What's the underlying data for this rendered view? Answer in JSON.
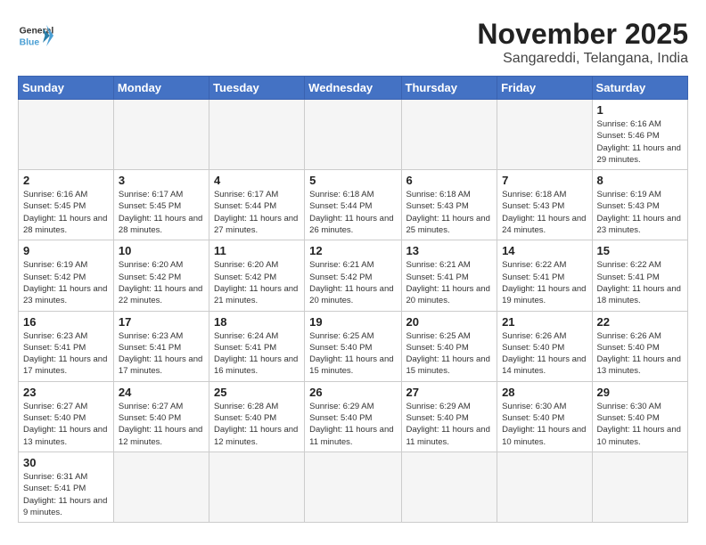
{
  "header": {
    "logo_general": "General",
    "logo_blue": "Blue",
    "month_title": "November 2025",
    "location": "Sangareddi, Telangana, India"
  },
  "days_of_week": [
    "Sunday",
    "Monday",
    "Tuesday",
    "Wednesday",
    "Thursday",
    "Friday",
    "Saturday"
  ],
  "weeks": [
    [
      {
        "day": "",
        "empty": true
      },
      {
        "day": "",
        "empty": true
      },
      {
        "day": "",
        "empty": true
      },
      {
        "day": "",
        "empty": true
      },
      {
        "day": "",
        "empty": true
      },
      {
        "day": "",
        "empty": true
      },
      {
        "day": "1",
        "sunrise": "6:16 AM",
        "sunset": "5:46 PM",
        "daylight": "11 hours and 29 minutes."
      }
    ],
    [
      {
        "day": "2",
        "sunrise": "6:16 AM",
        "sunset": "5:45 PM",
        "daylight": "11 hours and 28 minutes."
      },
      {
        "day": "3",
        "sunrise": "6:17 AM",
        "sunset": "5:45 PM",
        "daylight": "11 hours and 28 minutes."
      },
      {
        "day": "4",
        "sunrise": "6:17 AM",
        "sunset": "5:44 PM",
        "daylight": "11 hours and 27 minutes."
      },
      {
        "day": "5",
        "sunrise": "6:18 AM",
        "sunset": "5:44 PM",
        "daylight": "11 hours and 26 minutes."
      },
      {
        "day": "6",
        "sunrise": "6:18 AM",
        "sunset": "5:43 PM",
        "daylight": "11 hours and 25 minutes."
      },
      {
        "day": "7",
        "sunrise": "6:18 AM",
        "sunset": "5:43 PM",
        "daylight": "11 hours and 24 minutes."
      },
      {
        "day": "8",
        "sunrise": "6:19 AM",
        "sunset": "5:43 PM",
        "daylight": "11 hours and 23 minutes."
      }
    ],
    [
      {
        "day": "9",
        "sunrise": "6:19 AM",
        "sunset": "5:42 PM",
        "daylight": "11 hours and 23 minutes."
      },
      {
        "day": "10",
        "sunrise": "6:20 AM",
        "sunset": "5:42 PM",
        "daylight": "11 hours and 22 minutes."
      },
      {
        "day": "11",
        "sunrise": "6:20 AM",
        "sunset": "5:42 PM",
        "daylight": "11 hours and 21 minutes."
      },
      {
        "day": "12",
        "sunrise": "6:21 AM",
        "sunset": "5:42 PM",
        "daylight": "11 hours and 20 minutes."
      },
      {
        "day": "13",
        "sunrise": "6:21 AM",
        "sunset": "5:41 PM",
        "daylight": "11 hours and 20 minutes."
      },
      {
        "day": "14",
        "sunrise": "6:22 AM",
        "sunset": "5:41 PM",
        "daylight": "11 hours and 19 minutes."
      },
      {
        "day": "15",
        "sunrise": "6:22 AM",
        "sunset": "5:41 PM",
        "daylight": "11 hours and 18 minutes."
      }
    ],
    [
      {
        "day": "16",
        "sunrise": "6:23 AM",
        "sunset": "5:41 PM",
        "daylight": "11 hours and 17 minutes."
      },
      {
        "day": "17",
        "sunrise": "6:23 AM",
        "sunset": "5:41 PM",
        "daylight": "11 hours and 17 minutes."
      },
      {
        "day": "18",
        "sunrise": "6:24 AM",
        "sunset": "5:41 PM",
        "daylight": "11 hours and 16 minutes."
      },
      {
        "day": "19",
        "sunrise": "6:25 AM",
        "sunset": "5:40 PM",
        "daylight": "11 hours and 15 minutes."
      },
      {
        "day": "20",
        "sunrise": "6:25 AM",
        "sunset": "5:40 PM",
        "daylight": "11 hours and 15 minutes."
      },
      {
        "day": "21",
        "sunrise": "6:26 AM",
        "sunset": "5:40 PM",
        "daylight": "11 hours and 14 minutes."
      },
      {
        "day": "22",
        "sunrise": "6:26 AM",
        "sunset": "5:40 PM",
        "daylight": "11 hours and 13 minutes."
      }
    ],
    [
      {
        "day": "23",
        "sunrise": "6:27 AM",
        "sunset": "5:40 PM",
        "daylight": "11 hours and 13 minutes."
      },
      {
        "day": "24",
        "sunrise": "6:27 AM",
        "sunset": "5:40 PM",
        "daylight": "11 hours and 12 minutes."
      },
      {
        "day": "25",
        "sunrise": "6:28 AM",
        "sunset": "5:40 PM",
        "daylight": "11 hours and 12 minutes."
      },
      {
        "day": "26",
        "sunrise": "6:29 AM",
        "sunset": "5:40 PM",
        "daylight": "11 hours and 11 minutes."
      },
      {
        "day": "27",
        "sunrise": "6:29 AM",
        "sunset": "5:40 PM",
        "daylight": "11 hours and 11 minutes."
      },
      {
        "day": "28",
        "sunrise": "6:30 AM",
        "sunset": "5:40 PM",
        "daylight": "11 hours and 10 minutes."
      },
      {
        "day": "29",
        "sunrise": "6:30 AM",
        "sunset": "5:40 PM",
        "daylight": "11 hours and 10 minutes."
      }
    ],
    [
      {
        "day": "30",
        "sunrise": "6:31 AM",
        "sunset": "5:41 PM",
        "daylight": "11 hours and 9 minutes."
      },
      {
        "day": "",
        "empty": true
      },
      {
        "day": "",
        "empty": true
      },
      {
        "day": "",
        "empty": true
      },
      {
        "day": "",
        "empty": true
      },
      {
        "day": "",
        "empty": true
      },
      {
        "day": "",
        "empty": true
      }
    ]
  ]
}
